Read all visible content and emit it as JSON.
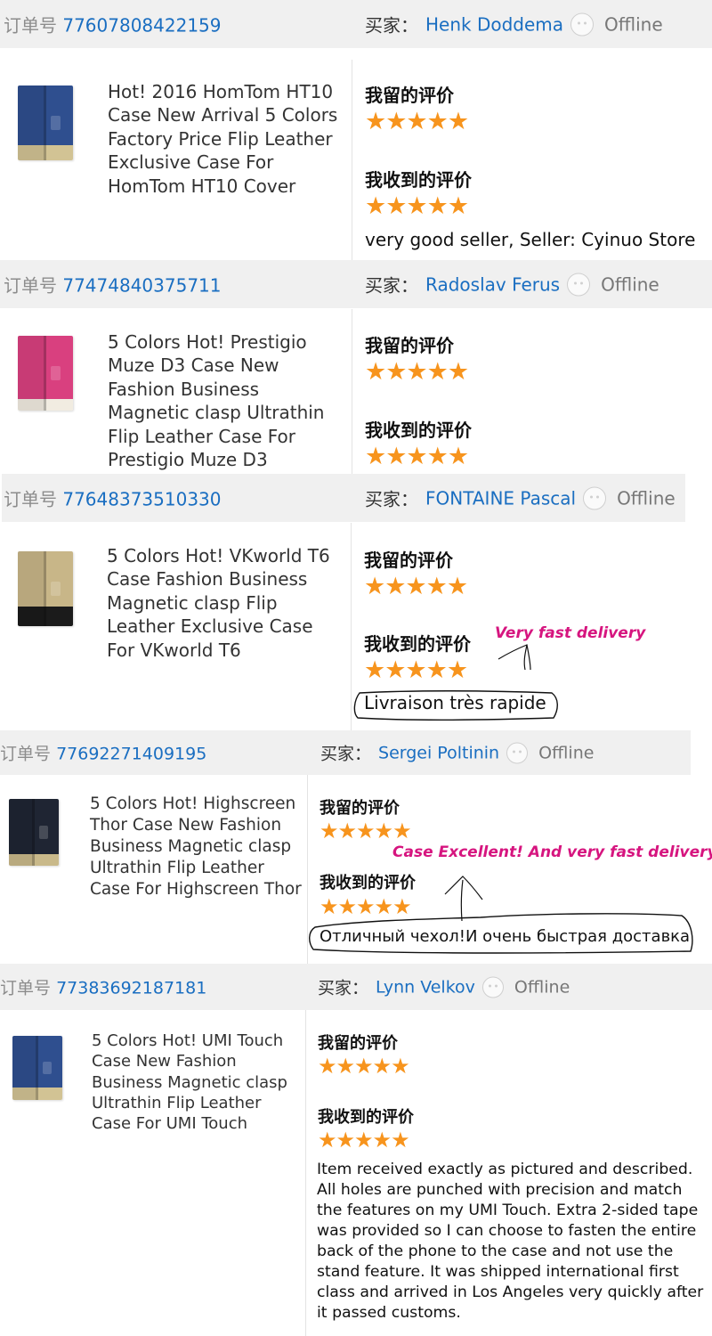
{
  "colors": {
    "link": "#1a6ec1",
    "star": "#f7941d",
    "annotation": "#d6157f",
    "header_bg": "#f0f0f0"
  },
  "labels": {
    "order_no": "订单号",
    "buyer": "买家：",
    "my_rating": "我留的评价",
    "received_rating": "我收到的评价",
    "stars": "★★★★★"
  },
  "orders": [
    {
      "order_number": "77607808422159",
      "buyer_name": "Henk Doddema",
      "status": "Offline",
      "product_title": "Hot! 2016 HomTom HT10 Case New Arrival 5 Colors Factory Price Flip Leather Exclusive Case For HomTom HT10 Cover",
      "product_color": "blue-gold",
      "my_rating_stars": 5,
      "received_rating_stars": 5,
      "comment": "very good seller, Seller: Cyinuo Store"
    },
    {
      "order_number": "77474840375711",
      "buyer_name": "Radoslav Ferus",
      "status": "Offline",
      "product_title": "5 Colors Hot! Prestigio Muze D3 Case New Fashion Business Magnetic clasp Ultrathin Flip Leather Case For Prestigio Muze D3",
      "product_color": "pink-white",
      "my_rating_stars": 5,
      "received_rating_stars": 5
    },
    {
      "order_number": "77648373510330",
      "buyer_name": "FONTAINE Pascal",
      "status": "Offline",
      "product_title": "5 Colors Hot! VKworld T6 Case Fashion Business Magnetic clasp Flip Leather Exclusive Case For VKworld T6",
      "product_color": "gold-black",
      "my_rating_stars": 5,
      "received_rating_stars": 5,
      "comment": "Livraison très rapide",
      "annotation": "Very fast delivery"
    },
    {
      "order_number": "77692271409195",
      "buyer_name": "Sergei Poltinin",
      "status": "Offline",
      "product_title": "5 Colors Hot! Highscreen Thor Case New Fashion Business Magnetic clasp Ultrathin Flip Leather Case For Highscreen Thor",
      "product_color": "black-gold",
      "my_rating_stars": 5,
      "received_rating_stars": 5,
      "comment": "Отличный чехол!И очень быстрая доставка",
      "annotation": "Case Excellent! And very fast delivery"
    },
    {
      "order_number": "77383692187181",
      "buyer_name": "Lynn Velkov",
      "status": "Offline",
      "product_title": "5 Colors Hot! UMI Touch Case New Fashion Business Magnetic clasp Ultrathin Flip Leather Case For UMI Touch",
      "product_color": "blue-gold",
      "my_rating_stars": 5,
      "received_rating_stars": 5,
      "comment": "Item received exactly as pictured and described. All holes are punched with precision and match the features on my UMI Touch. Extra 2-sided tape was provided so I can choose to fasten the entire back of the phone to the case and not use the stand feature. It was shipped international first class and arrived in Los Angeles very quickly after it passed customs."
    }
  ]
}
